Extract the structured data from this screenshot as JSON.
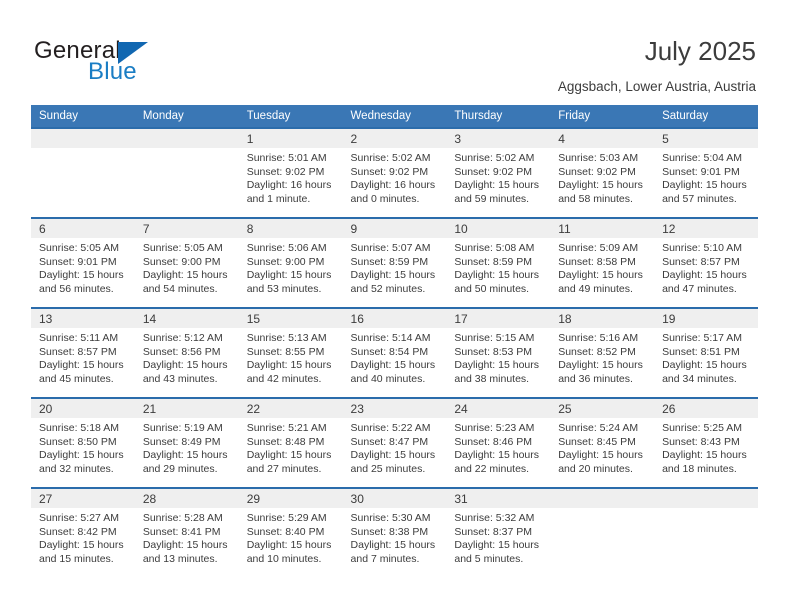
{
  "brand": {
    "name_part1": "General",
    "name_part2": "Blue",
    "logo_icon": "triangle-mark"
  },
  "header": {
    "title": "July 2025",
    "location": "Aggsbach, Lower Austria, Austria"
  },
  "calendar": {
    "weekday_headers": [
      "Sunday",
      "Monday",
      "Tuesday",
      "Wednesday",
      "Thursday",
      "Friday",
      "Saturday"
    ],
    "header_bg": "#3a77b5",
    "row_border": "#2b6cab",
    "daynum_bg": "#efefef",
    "weeks": [
      [
        {
          "day": "",
          "empty": true
        },
        {
          "day": "",
          "empty": true
        },
        {
          "day": "1",
          "sunrise": "Sunrise: 5:01 AM",
          "sunset": "Sunset: 9:02 PM",
          "daylight_line1": "Daylight: 16 hours",
          "daylight_line2": "and 1 minute."
        },
        {
          "day": "2",
          "sunrise": "Sunrise: 5:02 AM",
          "sunset": "Sunset: 9:02 PM",
          "daylight_line1": "Daylight: 16 hours",
          "daylight_line2": "and 0 minutes."
        },
        {
          "day": "3",
          "sunrise": "Sunrise: 5:02 AM",
          "sunset": "Sunset: 9:02 PM",
          "daylight_line1": "Daylight: 15 hours",
          "daylight_line2": "and 59 minutes."
        },
        {
          "day": "4",
          "sunrise": "Sunrise: 5:03 AM",
          "sunset": "Sunset: 9:02 PM",
          "daylight_line1": "Daylight: 15 hours",
          "daylight_line2": "and 58 minutes."
        },
        {
          "day": "5",
          "sunrise": "Sunrise: 5:04 AM",
          "sunset": "Sunset: 9:01 PM",
          "daylight_line1": "Daylight: 15 hours",
          "daylight_line2": "and 57 minutes."
        }
      ],
      [
        {
          "day": "6",
          "sunrise": "Sunrise: 5:05 AM",
          "sunset": "Sunset: 9:01 PM",
          "daylight_line1": "Daylight: 15 hours",
          "daylight_line2": "and 56 minutes."
        },
        {
          "day": "7",
          "sunrise": "Sunrise: 5:05 AM",
          "sunset": "Sunset: 9:00 PM",
          "daylight_line1": "Daylight: 15 hours",
          "daylight_line2": "and 54 minutes."
        },
        {
          "day": "8",
          "sunrise": "Sunrise: 5:06 AM",
          "sunset": "Sunset: 9:00 PM",
          "daylight_line1": "Daylight: 15 hours",
          "daylight_line2": "and 53 minutes."
        },
        {
          "day": "9",
          "sunrise": "Sunrise: 5:07 AM",
          "sunset": "Sunset: 8:59 PM",
          "daylight_line1": "Daylight: 15 hours",
          "daylight_line2": "and 52 minutes."
        },
        {
          "day": "10",
          "sunrise": "Sunrise: 5:08 AM",
          "sunset": "Sunset: 8:59 PM",
          "daylight_line1": "Daylight: 15 hours",
          "daylight_line2": "and 50 minutes."
        },
        {
          "day": "11",
          "sunrise": "Sunrise: 5:09 AM",
          "sunset": "Sunset: 8:58 PM",
          "daylight_line1": "Daylight: 15 hours",
          "daylight_line2": "and 49 minutes."
        },
        {
          "day": "12",
          "sunrise": "Sunrise: 5:10 AM",
          "sunset": "Sunset: 8:57 PM",
          "daylight_line1": "Daylight: 15 hours",
          "daylight_line2": "and 47 minutes."
        }
      ],
      [
        {
          "day": "13",
          "sunrise": "Sunrise: 5:11 AM",
          "sunset": "Sunset: 8:57 PM",
          "daylight_line1": "Daylight: 15 hours",
          "daylight_line2": "and 45 minutes."
        },
        {
          "day": "14",
          "sunrise": "Sunrise: 5:12 AM",
          "sunset": "Sunset: 8:56 PM",
          "daylight_line1": "Daylight: 15 hours",
          "daylight_line2": "and 43 minutes."
        },
        {
          "day": "15",
          "sunrise": "Sunrise: 5:13 AM",
          "sunset": "Sunset: 8:55 PM",
          "daylight_line1": "Daylight: 15 hours",
          "daylight_line2": "and 42 minutes."
        },
        {
          "day": "16",
          "sunrise": "Sunrise: 5:14 AM",
          "sunset": "Sunset: 8:54 PM",
          "daylight_line1": "Daylight: 15 hours",
          "daylight_line2": "and 40 minutes."
        },
        {
          "day": "17",
          "sunrise": "Sunrise: 5:15 AM",
          "sunset": "Sunset: 8:53 PM",
          "daylight_line1": "Daylight: 15 hours",
          "daylight_line2": "and 38 minutes."
        },
        {
          "day": "18",
          "sunrise": "Sunrise: 5:16 AM",
          "sunset": "Sunset: 8:52 PM",
          "daylight_line1": "Daylight: 15 hours",
          "daylight_line2": "and 36 minutes."
        },
        {
          "day": "19",
          "sunrise": "Sunrise: 5:17 AM",
          "sunset": "Sunset: 8:51 PM",
          "daylight_line1": "Daylight: 15 hours",
          "daylight_line2": "and 34 minutes."
        }
      ],
      [
        {
          "day": "20",
          "sunrise": "Sunrise: 5:18 AM",
          "sunset": "Sunset: 8:50 PM",
          "daylight_line1": "Daylight: 15 hours",
          "daylight_line2": "and 32 minutes."
        },
        {
          "day": "21",
          "sunrise": "Sunrise: 5:19 AM",
          "sunset": "Sunset: 8:49 PM",
          "daylight_line1": "Daylight: 15 hours",
          "daylight_line2": "and 29 minutes."
        },
        {
          "day": "22",
          "sunrise": "Sunrise: 5:21 AM",
          "sunset": "Sunset: 8:48 PM",
          "daylight_line1": "Daylight: 15 hours",
          "daylight_line2": "and 27 minutes."
        },
        {
          "day": "23",
          "sunrise": "Sunrise: 5:22 AM",
          "sunset": "Sunset: 8:47 PM",
          "daylight_line1": "Daylight: 15 hours",
          "daylight_line2": "and 25 minutes."
        },
        {
          "day": "24",
          "sunrise": "Sunrise: 5:23 AM",
          "sunset": "Sunset: 8:46 PM",
          "daylight_line1": "Daylight: 15 hours",
          "daylight_line2": "and 22 minutes."
        },
        {
          "day": "25",
          "sunrise": "Sunrise: 5:24 AM",
          "sunset": "Sunset: 8:45 PM",
          "daylight_line1": "Daylight: 15 hours",
          "daylight_line2": "and 20 minutes."
        },
        {
          "day": "26",
          "sunrise": "Sunrise: 5:25 AM",
          "sunset": "Sunset: 8:43 PM",
          "daylight_line1": "Daylight: 15 hours",
          "daylight_line2": "and 18 minutes."
        }
      ],
      [
        {
          "day": "27",
          "sunrise": "Sunrise: 5:27 AM",
          "sunset": "Sunset: 8:42 PM",
          "daylight_line1": "Daylight: 15 hours",
          "daylight_line2": "and 15 minutes."
        },
        {
          "day": "28",
          "sunrise": "Sunrise: 5:28 AM",
          "sunset": "Sunset: 8:41 PM",
          "daylight_line1": "Daylight: 15 hours",
          "daylight_line2": "and 13 minutes."
        },
        {
          "day": "29",
          "sunrise": "Sunrise: 5:29 AM",
          "sunset": "Sunset: 8:40 PM",
          "daylight_line1": "Daylight: 15 hours",
          "daylight_line2": "and 10 minutes."
        },
        {
          "day": "30",
          "sunrise": "Sunrise: 5:30 AM",
          "sunset": "Sunset: 8:38 PM",
          "daylight_line1": "Daylight: 15 hours",
          "daylight_line2": "and 7 minutes."
        },
        {
          "day": "31",
          "sunrise": "Sunrise: 5:32 AM",
          "sunset": "Sunset: 8:37 PM",
          "daylight_line1": "Daylight: 15 hours",
          "daylight_line2": "and 5 minutes."
        },
        {
          "day": "",
          "empty": true
        },
        {
          "day": "",
          "empty": true
        }
      ]
    ]
  }
}
